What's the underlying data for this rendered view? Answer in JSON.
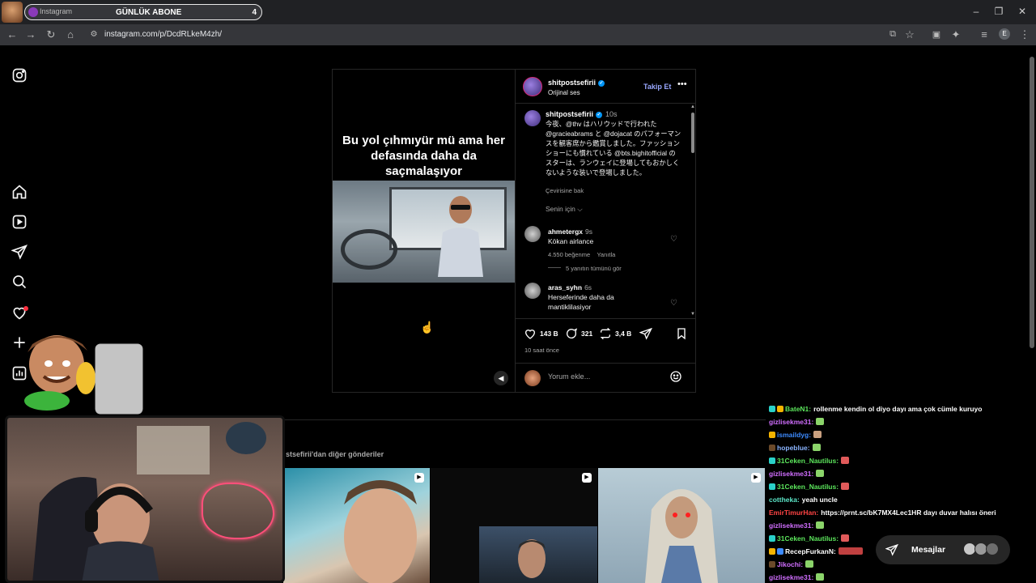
{
  "browser": {
    "tab": {
      "site": "Instagram",
      "title": "GÜNLÜK ABONE",
      "count": "4"
    },
    "url": "instagram.com/p/DcdRLkeM4zh/",
    "profile_initial": "E"
  },
  "nav": {
    "icons": [
      "instagram-logo-icon",
      "home-icon",
      "reels-icon",
      "direct-icon",
      "search-icon",
      "notifications-icon",
      "create-icon",
      "dashboard-icon"
    ]
  },
  "post": {
    "video_caption": "Bu yol çıhmıyür mü ama her defasında daha da saçmalaşıyor",
    "author": "shitpostsefirii",
    "audio": "Orijinal ses",
    "follow_label": "Takip Et",
    "more_label": "•••",
    "caption": {
      "user": "shitpostsefirii",
      "time": "10s",
      "text": "今夜、@thv はハリウッドで行われた @gracieabrams と @dojacat のパフォーマンスを観客席から鑑賞しました。ファッションショーにも慣れている @bts.bighitofficial のスターは、ランウェイに登場してもおかしくないような装いで登場しました。",
      "translate": "Çevirisine bak"
    },
    "for_you": "Senin için ⌵",
    "comments": [
      {
        "user": "ahmetergx",
        "time": "9s",
        "text": "Kökan airlance",
        "likes": "4.550 beğenme",
        "reply": "Yanıtla"
      },
      {
        "user": "aras_syhn",
        "time": "6s",
        "text": "Herseferinde daha da mantiklilasiyor"
      }
    ],
    "view_replies": "5 yanıtın tümünü gör",
    "likes_count": "143 B",
    "comments_count": "321",
    "reposts_count": "3,4 B",
    "post_time": "10 saat önce",
    "comment_placeholder": "Yorum ekle...",
    "mute_icon": "speaker-icon"
  },
  "more_posts": {
    "label": "stsefirii'dan diğer gönderiler"
  },
  "chat": {
    "lines": [
      {
        "user": "BateN1:",
        "color": "#5ce65c",
        "msg": "rollenme kendin ol diyo dayı ama çok cümle kuruyo"
      },
      {
        "user": "gizlisekme31:",
        "color": "#d16eff",
        "msg": ""
      },
      {
        "user": "ismaildyg:",
        "color": "#3d8bff",
        "msg": ""
      },
      {
        "user": "hopeblue:",
        "color": "#8ab4ff",
        "msg": ""
      },
      {
        "user": "31Ceken_Nautilus:",
        "color": "#5ce65c",
        "msg": ""
      },
      {
        "user": "gizlisekme31:",
        "color": "#d16eff",
        "msg": ""
      },
      {
        "user": "31Ceken_Nautilus:",
        "color": "#5ce65c",
        "msg": ""
      },
      {
        "user": "cottheka:",
        "color": "#5ce6c8",
        "msg": "yeah uncle"
      },
      {
        "user": "EmirTimurHan:",
        "color": "#ff4444",
        "msg": "https://prnt.sc/bK7MX4Lec1HR dayı duvar halısı öneri"
      },
      {
        "user": "gizlisekme31:",
        "color": "#d16eff",
        "msg": ""
      },
      {
        "user": "31Ceken_Nautilus:",
        "color": "#5ce65c",
        "msg": ""
      },
      {
        "user": "RecepFurkanN:",
        "color": "#ffffff",
        "msg": ""
      },
      {
        "user": "Jikochi:",
        "color": "#d16eff",
        "msg": ""
      },
      {
        "user": "gizlisekme31:",
        "color": "#d16eff",
        "msg": ""
      }
    ]
  },
  "messages": {
    "label": "Mesajlar"
  },
  "colors": {
    "accent_link": "#e0f1ff",
    "follow": "#9aa8ff",
    "verified": "#0095f6"
  }
}
